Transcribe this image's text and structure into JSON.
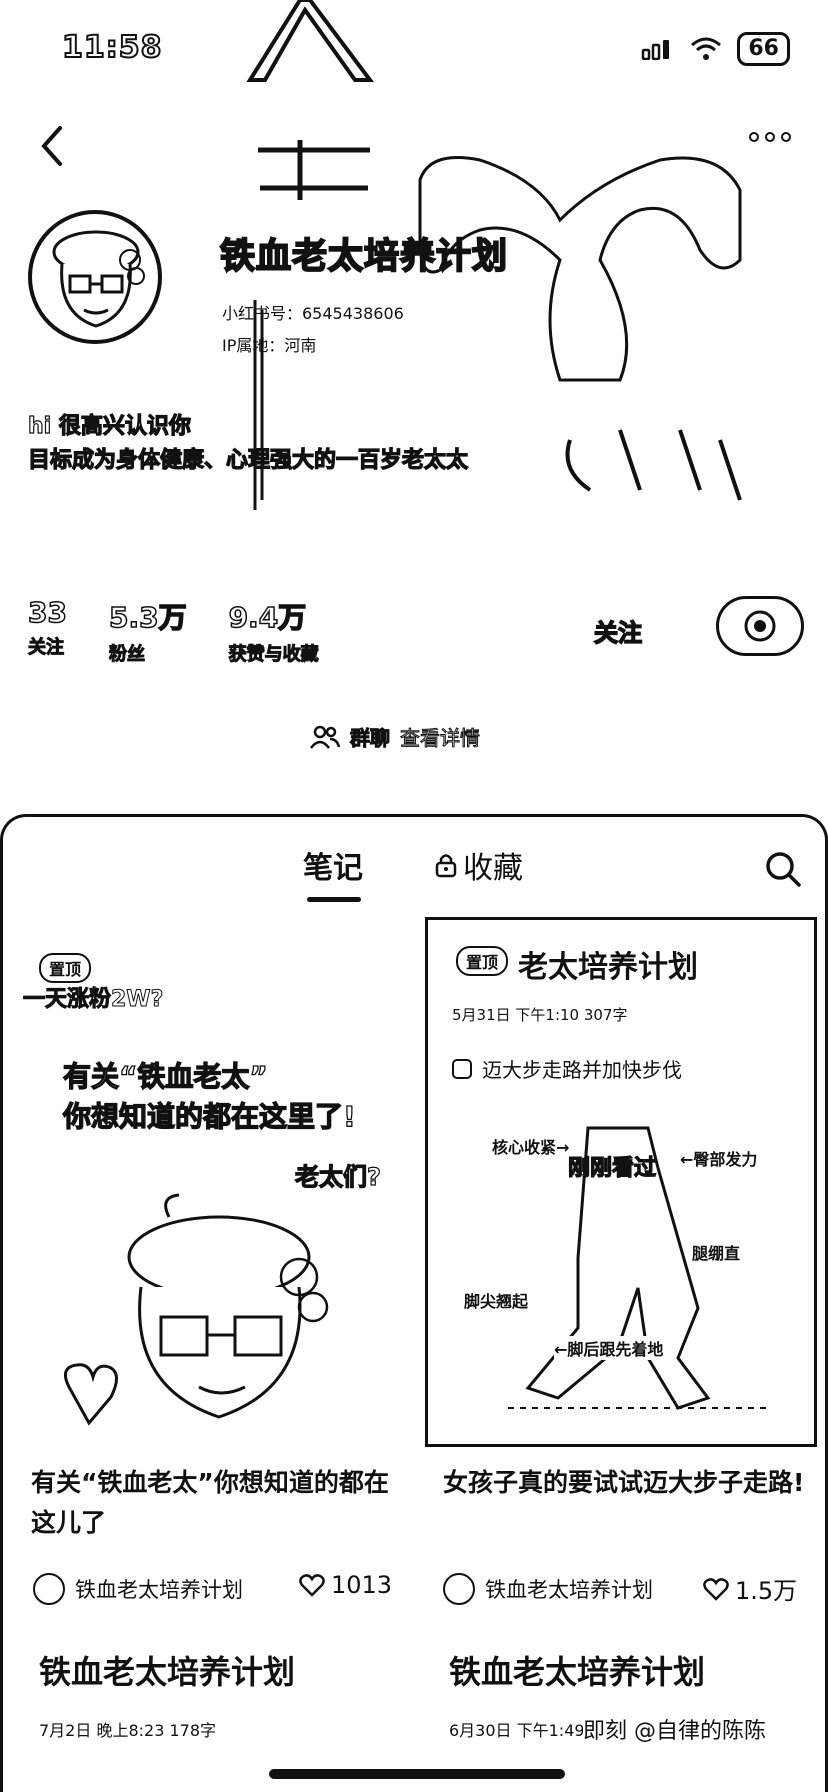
{
  "status": {
    "time": "11:58",
    "battery": "66"
  },
  "profile": {
    "name": "铁血老太培养计划",
    "id_text": "小红书号：6545438606",
    "ip_text": "IP属地：河南",
    "bio_line1": "hi 很高兴认识你",
    "bio_line2": "目标成为身体健康、心理强大的一百岁老太太"
  },
  "stats": [
    {
      "num": "33",
      "label": "关注"
    },
    {
      "num": "5.3万",
      "label": "粉丝"
    },
    {
      "num": "9.4万",
      "label": "获赞与收藏"
    }
  ],
  "actions": {
    "follow": "关注",
    "group_chat": "群聊",
    "group_detail": "查看详情"
  },
  "tabs": {
    "notes": "笔记",
    "favorites": "收藏"
  },
  "cards": [
    {
      "pin": "置顶",
      "overlay_top": "一天涨粉2W?",
      "heading_line1": "有关“铁血老太”",
      "heading_line2": "你想知道的都在这里了!",
      "tag": "老太们?",
      "title": "有关“铁血老太”你想知道的都在这儿了",
      "author": "铁血老太培养计划",
      "likes": "1013"
    },
    {
      "pin": "置顶",
      "cover_title": "老太培养计划",
      "meta": "5月31日  下午1:10    307字",
      "check": "迈大步走路并加快步伐",
      "labels": [
        "核心收紧→",
        "←臀部发力",
        "腿绷直",
        "脚尖翘起",
        "←脚后跟先着地"
      ],
      "viewed": "刚刚看过",
      "title": "女孩子真的要试试迈大步子走路!",
      "author": "铁血老太培养计划",
      "likes": "1.5万"
    },
    {
      "cover_title": "铁血老太培养计划",
      "meta": "7月2日  晚上8:23    178字"
    },
    {
      "cover_title": "铁血老太培养计划",
      "meta": "6月30日  下午1:49    482字"
    }
  ],
  "watermark": "即刻 @自律的陈陈"
}
